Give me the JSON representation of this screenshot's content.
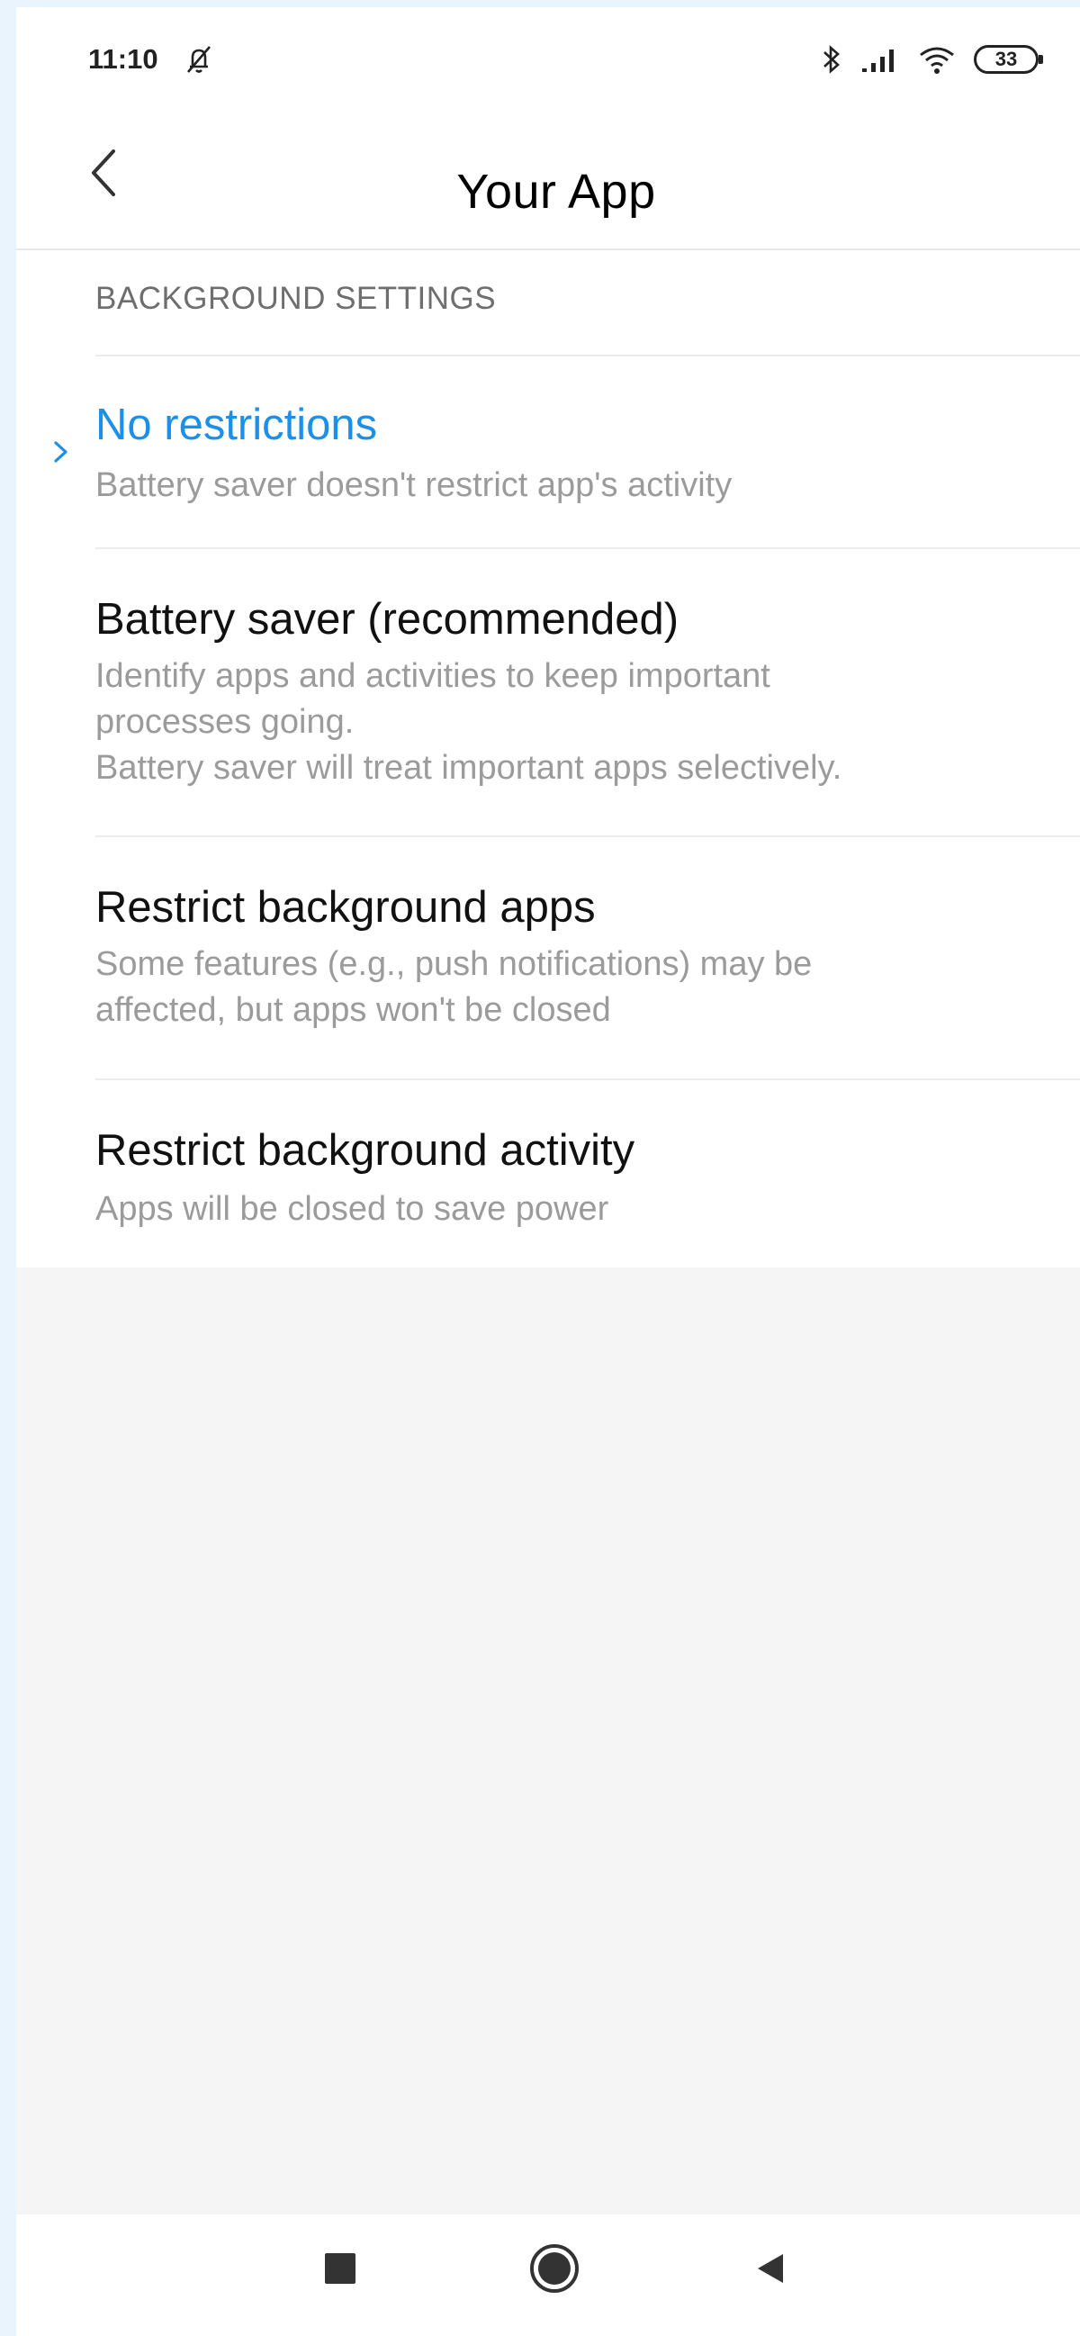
{
  "status_bar": {
    "time": "11:10",
    "icons": [
      "notifications-off-icon",
      "bluetooth-icon",
      "signal-icon",
      "wifi-icon",
      "battery-icon"
    ],
    "battery_level": "33"
  },
  "header": {
    "back_icon": "chevron-left-icon",
    "title": "Your App"
  },
  "section": {
    "header": "BACKGROUND SETTINGS"
  },
  "options": [
    {
      "title": "No restrictions",
      "description": "Battery saver doesn't restrict app's activity",
      "selected": true
    },
    {
      "title": "Battery saver (recommended)",
      "description": "Identify apps and activities to keep important\nprocesses going.\nBattery saver will treat important apps selectively.",
      "selected": false
    },
    {
      "title": "Restrict background apps",
      "description": "Some features (e.g., push notifications) may be\naffected, but apps won't be closed",
      "selected": false
    },
    {
      "title": "Restrict background activity",
      "description": "Apps will be closed to save power",
      "selected": false
    }
  ],
  "colors": {
    "accent": "#1e8fe6",
    "background": "#f5f5f5",
    "outer_background": "#eaf4fd"
  },
  "nav_bar": {
    "icons": [
      "recents-square-icon",
      "home-circle-icon",
      "back-triangle-icon"
    ]
  }
}
